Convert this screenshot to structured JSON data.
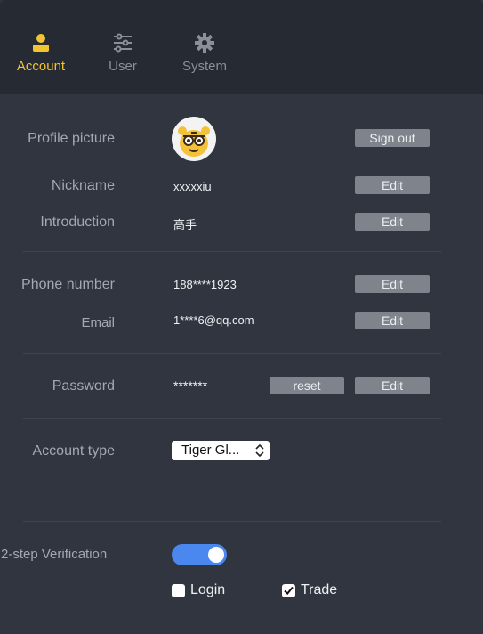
{
  "tabs": [
    {
      "label": "Account",
      "icon": "person-icon",
      "active": true
    },
    {
      "label": "User",
      "icon": "sliders-icon",
      "active": false
    },
    {
      "label": "System",
      "icon": "gear-icon",
      "active": false
    }
  ],
  "profile": {
    "picture_label": "Profile picture",
    "sign_out_label": "Sign out",
    "nickname_label": "Nickname",
    "nickname_value": "xxxxxiu",
    "intro_label": "Introduction",
    "intro_value": "高手",
    "edit_label": "Edit"
  },
  "contact": {
    "phone_label": "Phone number",
    "phone_value": "188****1923",
    "email_label": "Email",
    "email_value": "1****6@qq.com"
  },
  "security": {
    "password_label": "Password",
    "password_value": "*******",
    "reset_label": "reset"
  },
  "account_type": {
    "label": "Account type",
    "selected": "Tiger Gl..."
  },
  "verification": {
    "label": "2-step Verification",
    "enabled": true,
    "options": [
      {
        "label": "Login",
        "checked": false
      },
      {
        "label": "Trade",
        "checked": true
      }
    ]
  },
  "colors": {
    "accent": "#f2c430",
    "toggle": "#4a87ef",
    "button": "#7e838c"
  }
}
